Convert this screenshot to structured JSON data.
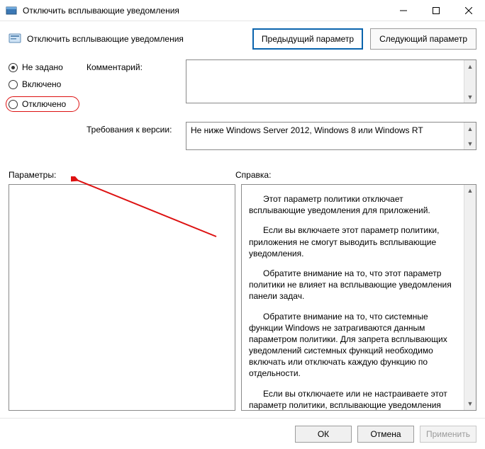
{
  "window": {
    "title": "Отключить всплывающие уведомления"
  },
  "header": {
    "title": "Отключить всплывающие уведомления",
    "prev_button": "Предыдущий параметр",
    "next_button": "Следующий параметр"
  },
  "radios": {
    "not_configured": "Не задано",
    "enabled": "Включено",
    "disabled": "Отключено",
    "selected": "not_configured",
    "highlighted": "disabled"
  },
  "labels": {
    "comment": "Комментарий:",
    "requirements": "Требования к версии:",
    "parameters": "Параметры:",
    "help": "Справка:"
  },
  "requirements_text": "Не ниже Windows Server 2012, Windows 8 или Windows RT",
  "help_paragraphs": {
    "p1": "Этот параметр политики отключает всплывающие уведомления для приложений.",
    "p2": "Если вы включаете этот параметр политики, приложения не смогут выводить всплывающие уведомления.",
    "p3": "Обратите внимание на то, что этот параметр политики не влияет на всплывающие уведомления панели задач.",
    "p4": "Обратите внимание на то, что системные функции Windows не затрагиваются данным параметром политики. Для запрета всплывающих уведомлений системных функций необходимо включать или отключать каждую функцию по отдельности.",
    "p5": "Если вы отключаете или не настраиваете этот параметр политики, всплывающие уведомления включены и могут быть отключены администратором или пользователем"
  },
  "footer": {
    "ok": "ОК",
    "cancel": "Отмена",
    "apply": "Применить"
  }
}
